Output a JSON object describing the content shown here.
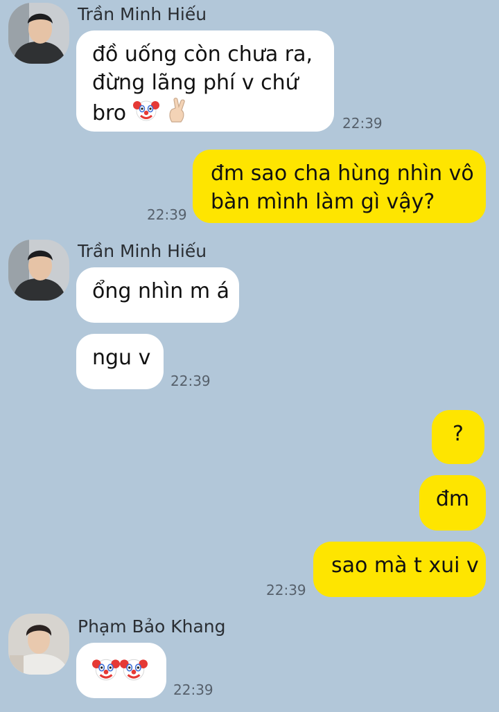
{
  "messages": [
    {
      "sender": "Trần Minh Hiếu",
      "lines": [
        "đồ uống còn chưa ra,",
        "đừng lãng phí v chứ",
        "bro"
      ],
      "emojis": [
        "clown-face",
        "crossed-fingers-light"
      ],
      "time": "22:39"
    },
    {
      "from_me": true,
      "lines": [
        "đm sao cha hùng nhìn vô",
        "bàn mình làm gì vậy?"
      ],
      "time": "22:39"
    },
    {
      "sender": "Trần Minh Hiếu",
      "text": "ổng nhìn m á"
    },
    {
      "text": "ngu v",
      "time": "22:39"
    },
    {
      "from_me": true,
      "text": "?"
    },
    {
      "from_me": true,
      "text": "đm"
    },
    {
      "from_me": true,
      "text": "sao mà t xui v",
      "time": "22:39"
    },
    {
      "sender": "Phạm Bảo Khang",
      "emojis": [
        "clown-face",
        "clown-face"
      ],
      "time": "22:39"
    }
  ],
  "colors": {
    "background": "#b2c7d9",
    "incoming_bubble": "#ffffff",
    "outgoing_bubble": "#fee500"
  }
}
